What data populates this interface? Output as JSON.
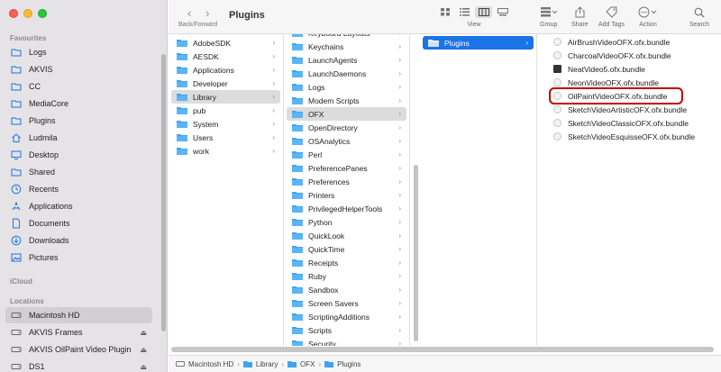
{
  "window": {
    "title": "Plugins",
    "nav_label": "Back/Forward"
  },
  "toolbar": {
    "view_label": "View",
    "group_label": "Group",
    "share_label": "Share",
    "addtags_label": "Add Tags",
    "action_label": "Action",
    "search_label": "Search"
  },
  "sidebar": {
    "favourites_heading": "Favourites",
    "icloud_heading": "iCloud",
    "locations_heading": "Locations",
    "favourites": [
      {
        "label": "Logs",
        "icon": "folder-icon"
      },
      {
        "label": "AKVIS",
        "icon": "folder-icon"
      },
      {
        "label": "CC",
        "icon": "folder-icon"
      },
      {
        "label": "MediaCore",
        "icon": "folder-icon"
      },
      {
        "label": "Plugins",
        "icon": "folder-icon"
      },
      {
        "label": "Ludmila",
        "icon": "home-icon"
      },
      {
        "label": "Desktop",
        "icon": "desktop-icon"
      },
      {
        "label": "Shared",
        "icon": "folder-icon"
      },
      {
        "label": "Recents",
        "icon": "clock-icon"
      },
      {
        "label": "Applications",
        "icon": "apps-icon"
      },
      {
        "label": "Documents",
        "icon": "document-icon"
      },
      {
        "label": "Downloads",
        "icon": "download-icon"
      },
      {
        "label": "Pictures",
        "icon": "picture-icon"
      }
    ],
    "locations": [
      {
        "label": "Macintosh HD",
        "icon": "disk-icon",
        "selected": true
      },
      {
        "label": "AKVIS Frames",
        "icon": "disk-icon",
        "eject": "⏏"
      },
      {
        "label": "AKVIS OilPaint Video Plugin",
        "icon": "disk-icon",
        "eject": "⏏"
      },
      {
        "label": "DS1",
        "icon": "disk-icon",
        "eject": "⏏"
      }
    ]
  },
  "columns": {
    "col1": [
      {
        "label": "AdobeSDK"
      },
      {
        "label": "AESDK"
      },
      {
        "label": "Applications"
      },
      {
        "label": "Developer"
      },
      {
        "label": "Library",
        "selected": true
      },
      {
        "label": "pub"
      },
      {
        "label": "System"
      },
      {
        "label": "Users"
      },
      {
        "label": "work"
      }
    ],
    "col2": [
      {
        "label": "Keyboard Layouts"
      },
      {
        "label": "Keychains"
      },
      {
        "label": "LaunchAgents"
      },
      {
        "label": "LaunchDaemons"
      },
      {
        "label": "Logs"
      },
      {
        "label": "Modem Scripts"
      },
      {
        "label": "OFX",
        "selected": true
      },
      {
        "label": "OpenDirectory"
      },
      {
        "label": "OSAnalytics"
      },
      {
        "label": "Perl"
      },
      {
        "label": "PreferencePanes"
      },
      {
        "label": "Preferences"
      },
      {
        "label": "Printers"
      },
      {
        "label": "PrivilegedHelperTools"
      },
      {
        "label": "Python"
      },
      {
        "label": "QuickLook"
      },
      {
        "label": "QuickTime"
      },
      {
        "label": "Receipts"
      },
      {
        "label": "Ruby"
      },
      {
        "label": "Sandbox"
      },
      {
        "label": "Screen Savers"
      },
      {
        "label": "ScriptingAdditions"
      },
      {
        "label": "Scripts"
      },
      {
        "label": "Security"
      }
    ],
    "col3": [
      {
        "label": "Plugins",
        "selected": true
      }
    ],
    "col4": [
      {
        "label": "AirBrushVideoOFX.ofx.bundle"
      },
      {
        "label": "CharcoalVideoOFX.ofx.bundle"
      },
      {
        "label": "NeatVideo5.ofx.bundle",
        "exec": true
      },
      {
        "label": "NeonVideoOFX.ofx.bundle"
      },
      {
        "label": "OilPaintVideoOFX.ofx.bundle",
        "highlighted": true
      },
      {
        "label": "SketchVideoArtisticOFX.ofx.bundle"
      },
      {
        "label": "SketchVideoClassicOFX.ofx.bundle"
      },
      {
        "label": "SketchVideoEsquisseOFX.ofx.bundle"
      }
    ]
  },
  "pathbar": [
    "Macintosh HD",
    "Library",
    "OFX",
    "Plugins"
  ],
  "colors": {
    "accent": "#1b73e8",
    "highlight": "#c40000",
    "folder": "#3fa4f0"
  }
}
